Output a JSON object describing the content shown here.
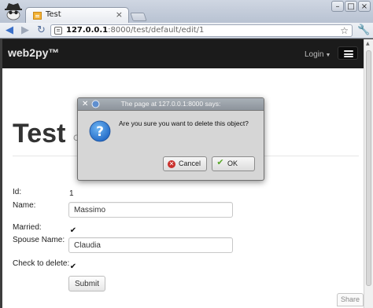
{
  "browser": {
    "tab_title": "Test",
    "tab_close": "×",
    "url_host": "127.0.0.1",
    "url_path": ":8000/test/default/edit/1",
    "icons": {
      "back": "back-arrow-icon",
      "forward": "forward-arrow-icon",
      "reload": "reload-icon",
      "bookmark": "star-icon",
      "menu": "wrench-icon"
    }
  },
  "navbar": {
    "brand": "web2py™",
    "login": "Login"
  },
  "page": {
    "title": "Test",
    "subtitle": "C",
    "fields": {
      "id_label": "Id:",
      "id_value": "1",
      "name_label": "Name:",
      "name_value": "Massimo",
      "married_label": "Married:",
      "married_checked": true,
      "spouse_label": "Spouse Name:",
      "spouse_value": "Claudia",
      "delete_label": "Check to delete:",
      "delete_checked": true
    },
    "submit": "Submit",
    "share": "Share"
  },
  "dialog": {
    "title": "The page at 127.0.0.1:8000 says:",
    "message": "Are you sure you want to delete this object?",
    "cancel": "Cancel",
    "ok": "OK"
  },
  "colors": {
    "navbar_bg": "#1b1b1b",
    "dialog_bg": "#d6d6d6",
    "question_icon": "#1f7ed6"
  }
}
